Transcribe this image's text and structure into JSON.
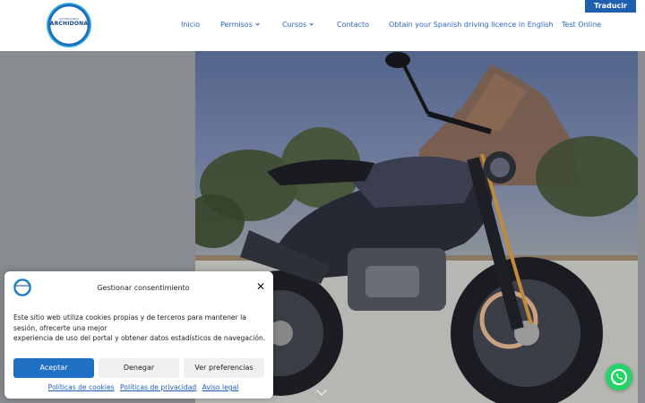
{
  "header": {
    "logo": {
      "small_text": "AUTOESCUELA",
      "name": "ARCHIDONA"
    },
    "nav": [
      {
        "label": "Inicio"
      },
      {
        "label": "Permisos"
      },
      {
        "label": "Cursos"
      },
      {
        "label": "Contacto"
      },
      {
        "label": "Obtain your Spanish driving licence in English"
      },
      {
        "label": "Test Online"
      }
    ],
    "translate_label": "Traducir"
  },
  "hero": {
    "image": "motorcycle-photo",
    "scroll_icon": "chevron-down-icon"
  },
  "cookie_dialog": {
    "title": "Gestionar consentimiento",
    "text_lines": [
      "Este sitio web utiliza cookies propias y de terceros para mantener la",
      "sesión, ofrecerte una mejor",
      "experiencia de uso del portal y obtener datos estadísticos de navegación."
    ],
    "buttons": {
      "accept": "Aceptar",
      "deny": "Denegar",
      "preferences": "Ver preferencias"
    },
    "links": [
      "Políticas de cookies",
      "Políticas de privacidad",
      "Aviso legal"
    ]
  },
  "whatsapp": {
    "icon": "whatsapp-icon"
  },
  "colors": {
    "brand_blue": "#1f5fae",
    "nav_text": "#2b67b8",
    "accept_button": "#1f6fc4",
    "whatsapp_green": "#25d366"
  }
}
